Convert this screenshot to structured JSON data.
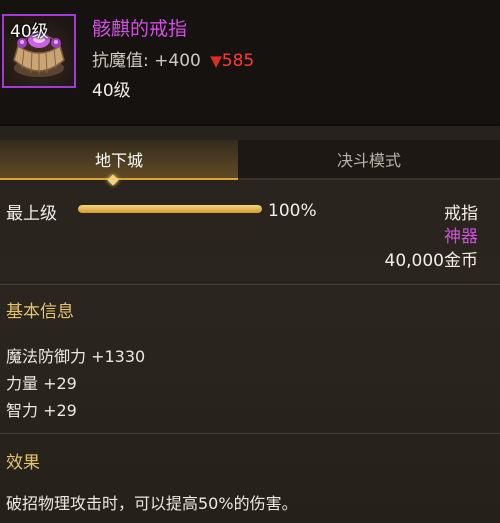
{
  "item": {
    "icon_level": "40级",
    "name": "骸麒的戒指",
    "resist_label": "抗魔值:",
    "resist_value": "+400",
    "resist_total": "585",
    "level": "40级",
    "icon": "ring-icon",
    "name_color": "#d24ee0"
  },
  "tabs": [
    {
      "label": "地下城",
      "active": true
    },
    {
      "label": "决斗模式",
      "active": false
    }
  ],
  "upgrade": {
    "label": "最上级",
    "progress": 1.0,
    "percent_text": "100%"
  },
  "meta": {
    "type": "戒指",
    "rarity": "神器",
    "price": "40,000金币"
  },
  "basic_info": {
    "title": "基本信息",
    "stats": [
      "魔法防御力 +1330",
      "力量 +29",
      "智力 +29"
    ]
  },
  "effect": {
    "title": "效果",
    "text": "破招物理攻击时，可以提高50%的伤害。"
  },
  "colors": {
    "accent_gold": "#d9a53a",
    "rarity_purple": "#d24ee0",
    "decrease_red": "#e02a1f"
  }
}
